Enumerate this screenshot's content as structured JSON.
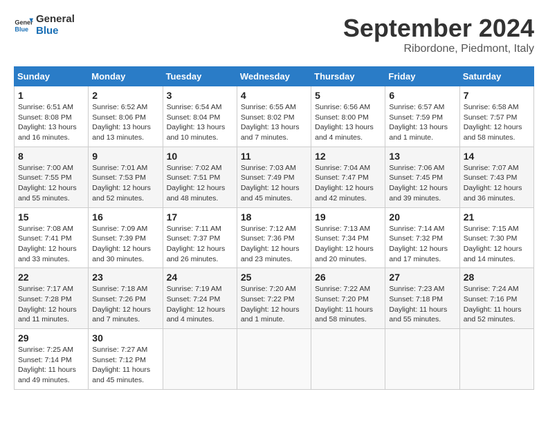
{
  "logo": {
    "line1": "General",
    "line2": "Blue"
  },
  "title": "September 2024",
  "subtitle": "Ribordone, Piedmont, Italy",
  "weekdays": [
    "Sunday",
    "Monday",
    "Tuesday",
    "Wednesday",
    "Thursday",
    "Friday",
    "Saturday"
  ],
  "weeks": [
    [
      {
        "day": "1",
        "info": "Sunrise: 6:51 AM\nSunset: 8:08 PM\nDaylight: 13 hours\nand 16 minutes."
      },
      {
        "day": "2",
        "info": "Sunrise: 6:52 AM\nSunset: 8:06 PM\nDaylight: 13 hours\nand 13 minutes."
      },
      {
        "day": "3",
        "info": "Sunrise: 6:54 AM\nSunset: 8:04 PM\nDaylight: 13 hours\nand 10 minutes."
      },
      {
        "day": "4",
        "info": "Sunrise: 6:55 AM\nSunset: 8:02 PM\nDaylight: 13 hours\nand 7 minutes."
      },
      {
        "day": "5",
        "info": "Sunrise: 6:56 AM\nSunset: 8:00 PM\nDaylight: 13 hours\nand 4 minutes."
      },
      {
        "day": "6",
        "info": "Sunrise: 6:57 AM\nSunset: 7:59 PM\nDaylight: 13 hours\nand 1 minute."
      },
      {
        "day": "7",
        "info": "Sunrise: 6:58 AM\nSunset: 7:57 PM\nDaylight: 12 hours\nand 58 minutes."
      }
    ],
    [
      {
        "day": "8",
        "info": "Sunrise: 7:00 AM\nSunset: 7:55 PM\nDaylight: 12 hours\nand 55 minutes."
      },
      {
        "day": "9",
        "info": "Sunrise: 7:01 AM\nSunset: 7:53 PM\nDaylight: 12 hours\nand 52 minutes."
      },
      {
        "day": "10",
        "info": "Sunrise: 7:02 AM\nSunset: 7:51 PM\nDaylight: 12 hours\nand 48 minutes."
      },
      {
        "day": "11",
        "info": "Sunrise: 7:03 AM\nSunset: 7:49 PM\nDaylight: 12 hours\nand 45 minutes."
      },
      {
        "day": "12",
        "info": "Sunrise: 7:04 AM\nSunset: 7:47 PM\nDaylight: 12 hours\nand 42 minutes."
      },
      {
        "day": "13",
        "info": "Sunrise: 7:06 AM\nSunset: 7:45 PM\nDaylight: 12 hours\nand 39 minutes."
      },
      {
        "day": "14",
        "info": "Sunrise: 7:07 AM\nSunset: 7:43 PM\nDaylight: 12 hours\nand 36 minutes."
      }
    ],
    [
      {
        "day": "15",
        "info": "Sunrise: 7:08 AM\nSunset: 7:41 PM\nDaylight: 12 hours\nand 33 minutes."
      },
      {
        "day": "16",
        "info": "Sunrise: 7:09 AM\nSunset: 7:39 PM\nDaylight: 12 hours\nand 30 minutes."
      },
      {
        "day": "17",
        "info": "Sunrise: 7:11 AM\nSunset: 7:37 PM\nDaylight: 12 hours\nand 26 minutes."
      },
      {
        "day": "18",
        "info": "Sunrise: 7:12 AM\nSunset: 7:36 PM\nDaylight: 12 hours\nand 23 minutes."
      },
      {
        "day": "19",
        "info": "Sunrise: 7:13 AM\nSunset: 7:34 PM\nDaylight: 12 hours\nand 20 minutes."
      },
      {
        "day": "20",
        "info": "Sunrise: 7:14 AM\nSunset: 7:32 PM\nDaylight: 12 hours\nand 17 minutes."
      },
      {
        "day": "21",
        "info": "Sunrise: 7:15 AM\nSunset: 7:30 PM\nDaylight: 12 hours\nand 14 minutes."
      }
    ],
    [
      {
        "day": "22",
        "info": "Sunrise: 7:17 AM\nSunset: 7:28 PM\nDaylight: 12 hours\nand 11 minutes."
      },
      {
        "day": "23",
        "info": "Sunrise: 7:18 AM\nSunset: 7:26 PM\nDaylight: 12 hours\nand 7 minutes."
      },
      {
        "day": "24",
        "info": "Sunrise: 7:19 AM\nSunset: 7:24 PM\nDaylight: 12 hours\nand 4 minutes."
      },
      {
        "day": "25",
        "info": "Sunrise: 7:20 AM\nSunset: 7:22 PM\nDaylight: 12 hours\nand 1 minute."
      },
      {
        "day": "26",
        "info": "Sunrise: 7:22 AM\nSunset: 7:20 PM\nDaylight: 11 hours\nand 58 minutes."
      },
      {
        "day": "27",
        "info": "Sunrise: 7:23 AM\nSunset: 7:18 PM\nDaylight: 11 hours\nand 55 minutes."
      },
      {
        "day": "28",
        "info": "Sunrise: 7:24 AM\nSunset: 7:16 PM\nDaylight: 11 hours\nand 52 minutes."
      }
    ],
    [
      {
        "day": "29",
        "info": "Sunrise: 7:25 AM\nSunset: 7:14 PM\nDaylight: 11 hours\nand 49 minutes."
      },
      {
        "day": "30",
        "info": "Sunrise: 7:27 AM\nSunset: 7:12 PM\nDaylight: 11 hours\nand 45 minutes."
      },
      {
        "day": "",
        "info": ""
      },
      {
        "day": "",
        "info": ""
      },
      {
        "day": "",
        "info": ""
      },
      {
        "day": "",
        "info": ""
      },
      {
        "day": "",
        "info": ""
      }
    ]
  ]
}
